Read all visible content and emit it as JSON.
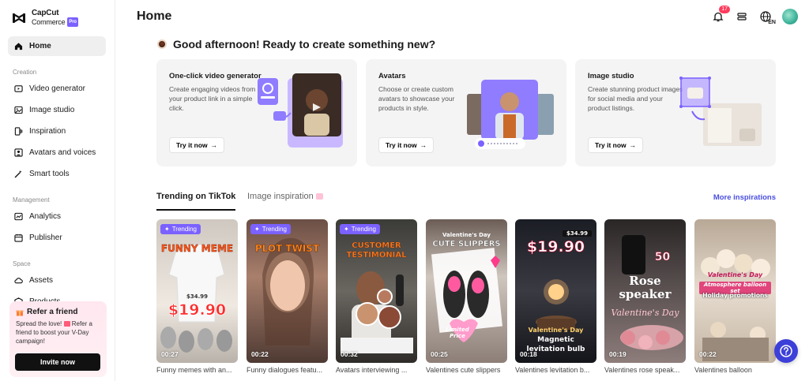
{
  "app": {
    "brand_line1": "CapCut",
    "brand_line2": "Commerce",
    "brand_badge": "Pro"
  },
  "sidebar": {
    "home": "Home",
    "section_creation": "Creation",
    "video_generator": "Video generator",
    "image_studio": "Image studio",
    "inspiration": "Inspiration",
    "avatars_voices": "Avatars and voices",
    "smart_tools": "Smart tools",
    "section_management": "Management",
    "analytics": "Analytics",
    "publisher": "Publisher",
    "section_space": "Space",
    "assets": "Assets",
    "products": "Products"
  },
  "refer": {
    "title": "Refer a friend",
    "desc_part1": "Spread the love!",
    "desc_part2": "Refer a friend to boost your V-Day campaign!",
    "button": "Invite now"
  },
  "header": {
    "title": "Home",
    "notif_count": "17",
    "lang": "EN"
  },
  "greeting": "Good afternoon! Ready to create something new?",
  "cards": [
    {
      "title": "One-click video generator",
      "desc": "Create engaging videos from your product link in a simple click.",
      "button": "Try it now"
    },
    {
      "title": "Avatars",
      "desc": "Choose or create custom avatars to showcase your products in style.",
      "button": "Try it now"
    },
    {
      "title": "Image studio",
      "desc": "Create stunning product images for social media and your product listings.",
      "button": "Try it now"
    }
  ],
  "tabs": {
    "trending": "Trending on TikTok",
    "image_inspiration": "Image inspiration",
    "more": "More inspirations"
  },
  "thumbs": [
    {
      "badge": "Trending",
      "headline": "FUNNY MEME",
      "price": "$19.90",
      "small_price": "$34.99",
      "duration": "00:27",
      "caption": "Funny memes with an..."
    },
    {
      "badge": "Trending",
      "headline": "PLOT TWIST",
      "duration": "00:22",
      "caption": "Funny dialogues featu..."
    },
    {
      "badge": "Trending",
      "headline": "CUSTOMER TESTIMONIAL",
      "duration": "00:32",
      "caption": "Avatars interviewing ..."
    },
    {
      "headline_small": "Valentine's Day",
      "headline": "CUTE SLIPPERS",
      "sticker": "Limited Price",
      "duration": "00:25",
      "caption": "Valentines cute slippers"
    },
    {
      "small_price": "$34.99",
      "price": "$19.90",
      "line1": "Valentine's Day",
      "line2": "Magnetic",
      "line3": "levitation bulb",
      "duration": "00:18",
      "caption": "Valentines levitation b..."
    },
    {
      "number": "50",
      "headline": "Rose speaker",
      "script": "Valentine's Day",
      "duration": "00:19",
      "caption": "Valentines rose speak..."
    },
    {
      "script1": "Valentine's Day",
      "script2": "Atmosphere balloon set",
      "line3": "Holiday promotions",
      "duration": "00:22",
      "caption": "Valentines balloon"
    }
  ]
}
